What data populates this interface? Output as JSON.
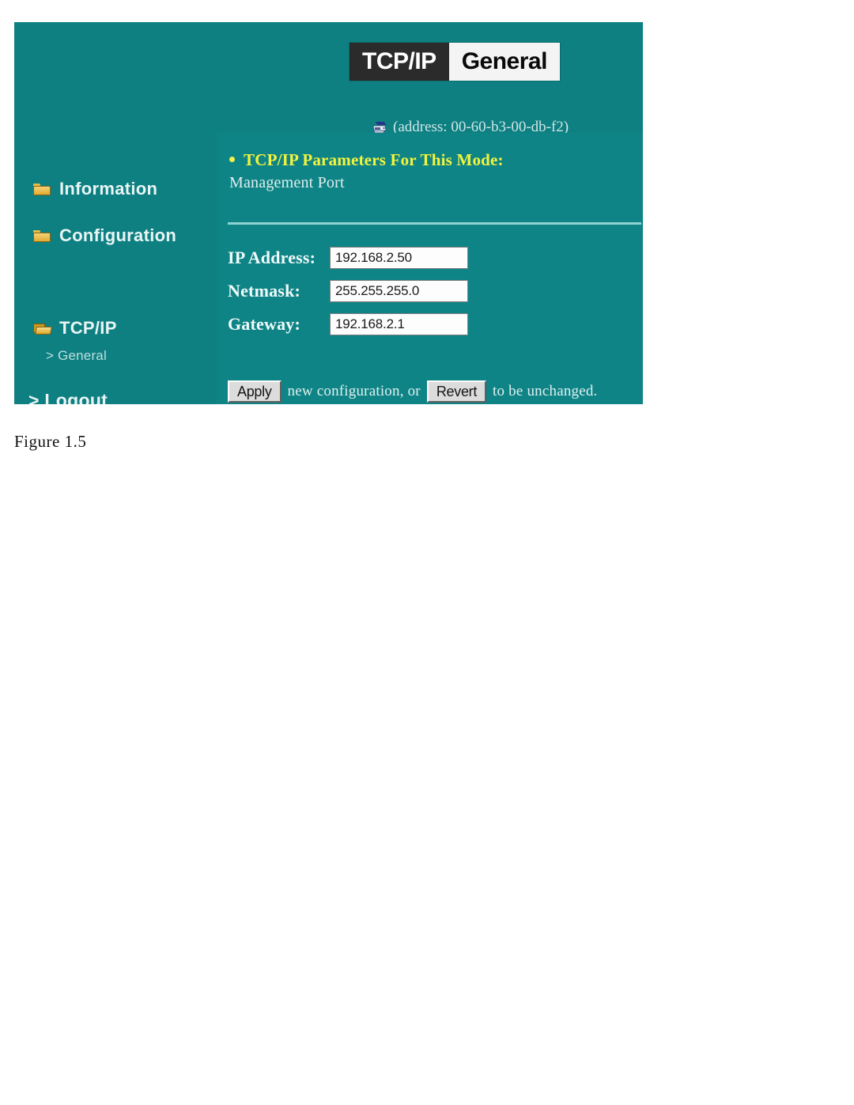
{
  "figure": {
    "caption": "Figure 1.5"
  },
  "header": {
    "tab_active": "TCP/IP",
    "tab_current": "General",
    "device_address": "(address: 00-60-b3-00-db-f2)",
    "printer_icon": "printer-icon"
  },
  "sidebar": {
    "items": [
      {
        "label": "Information",
        "icon": "closed-folder-icon"
      },
      {
        "label": "Configuration",
        "icon": "closed-folder-icon"
      },
      {
        "label": "TCP/IP",
        "icon": "open-folder-icon"
      },
      {
        "label": "> General",
        "icon": "none"
      },
      {
        "label": "> Logout",
        "icon": "none"
      }
    ]
  },
  "content": {
    "heading": "TCP/IP Parameters For This Mode:",
    "subheading": "Management Port",
    "fields": [
      {
        "label": "IP Address:",
        "value": "192.168.2.50"
      },
      {
        "label": "Netmask:",
        "value": "255.255.255.0"
      },
      {
        "label": "Gateway:",
        "value": "192.168.2.1"
      }
    ],
    "actions": {
      "apply_label": "Apply",
      "text_after_apply": "new configuration, or",
      "revert_label": "Revert",
      "text_after_revert": "to be unchanged."
    }
  },
  "colors": {
    "panel_teal": "#0e8082",
    "content_teal": "#0f8486",
    "heading_yellow": "#f4f43c",
    "tab_dark": "#2b2b2b",
    "tab_light": "#f4f4f4",
    "divider": "#8fd3d2"
  }
}
